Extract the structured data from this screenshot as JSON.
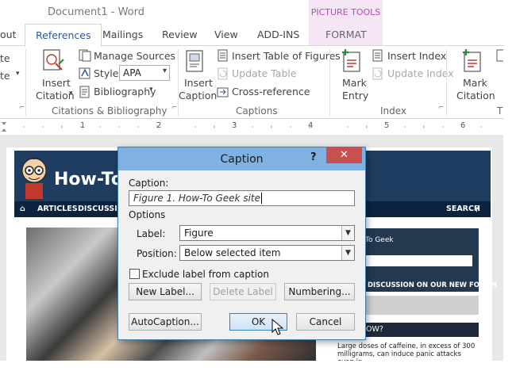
{
  "window": {
    "title": "Document1 - Word",
    "context_group": "PICTURE TOOLS"
  },
  "tabs": [
    {
      "label": "out"
    },
    {
      "label": "References"
    },
    {
      "label": "Mailings"
    },
    {
      "label": "Review"
    },
    {
      "label": "View"
    },
    {
      "label": "ADD-INS"
    },
    {
      "label": "FORMAT"
    }
  ],
  "ribbon": {
    "left_cut_1": "te",
    "left_cut_2": "te",
    "insert_citation_1": "Insert",
    "insert_citation_2": "Citation",
    "manage_sources": "Manage Sources",
    "style_label": "Style:",
    "style_value": "APA",
    "bibliography": "Bibliography",
    "group_citations": "Citations & Bibliography",
    "insert_caption_1": "Insert",
    "insert_caption_2": "Caption",
    "insert_table_of_figures": "Insert Table of Figures",
    "update_table": "Update Table",
    "cross_reference": "Cross-reference",
    "group_captions": "Captions",
    "mark_entry_1": "Mark",
    "mark_entry_2": "Entry",
    "insert_index": "Insert Index",
    "update_index": "Update Index",
    "group_index": "Index",
    "mark_citation_1": "Mark",
    "mark_citation_2": "Citation",
    "group_cut": "T"
  },
  "ruler": {
    "marks": [
      "1",
      "2",
      "3",
      "4",
      "5",
      "6"
    ]
  },
  "background_page": {
    "site_name": "How-To G",
    "nav_articles": "ARTICLES",
    "nav_discussion": "DISCUSSION",
    "nav_search": "SEARCH",
    "side_title": "To Geek",
    "side_forum": "DISCUSSION ON OUR NEW FORUM",
    "side_how": "OW?",
    "side_body": "Large doses of caffeine, in excess of 300 milligrams, can induce panic attacks even in"
  },
  "dialog": {
    "title": "Caption",
    "help": "?",
    "close": "✕",
    "caption_label": "Caption:",
    "caption_value": "Figure 1. How-To Geek site",
    "options_label": "Options",
    "label_label": "Label:",
    "label_value": "Figure",
    "position_label": "Position:",
    "position_value": "Below selected item",
    "exclude_label": "Exclude label from caption",
    "new_label_button": "New Label...",
    "delete_label_button": "Delete Label",
    "numbering_button": "Numbering...",
    "autocaption_button": "AutoCaption...",
    "ok_button": "OK",
    "cancel_button": "Cancel"
  },
  "colors": {
    "accent": "#2b579a",
    "context_tab": "#b44bb8",
    "dialog_titlebar": "#7fb2e2",
    "close_button": "#c75050"
  }
}
